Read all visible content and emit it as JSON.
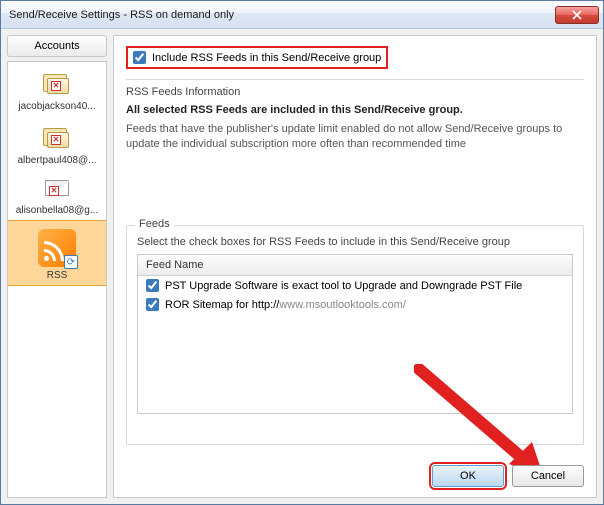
{
  "title": "Send/Receive Settings - RSS on demand only",
  "sidebar": {
    "header": "Accounts",
    "items": [
      {
        "label": "jacobjackson40..."
      },
      {
        "label": "albertpaul408@..."
      },
      {
        "label": "alisonbella08@g..."
      },
      {
        "label": "RSS"
      }
    ]
  },
  "include": {
    "label": "Include RSS Feeds in this Send/Receive group",
    "checked": true
  },
  "info": {
    "heading": "RSS Feeds Information",
    "bold": "All selected RSS Feeds are included in this Send/Receive group.",
    "desc": "Feeds that have the publisher's update limit enabled do not allow Send/Receive groups to update the individual subscription more often than recommended time"
  },
  "feeds": {
    "legend": "Feeds",
    "instr": "Select the check boxes for RSS Feeds to include in this Send/Receive group",
    "col": "Feed Name",
    "rows": [
      {
        "checked": true,
        "text": "PST Upgrade Software is exact tool to Upgrade and Downgrade PST File"
      },
      {
        "checked": true,
        "text_pre": "ROR Sitemap for http://",
        "text_dim": "www.msoutlooktools.com/"
      }
    ]
  },
  "buttons": {
    "ok": "OK",
    "cancel": "Cancel"
  }
}
